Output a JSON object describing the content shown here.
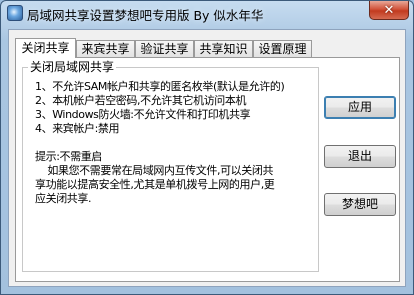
{
  "window": {
    "title": "局域网共享设置梦想吧专用版 By 似水年华",
    "close_symbol": "✕"
  },
  "tabs": [
    {
      "label": "关闭共享",
      "active": true
    },
    {
      "label": "来宾共享",
      "active": false
    },
    {
      "label": "验证共享",
      "active": false
    },
    {
      "label": "共享知识",
      "active": false
    },
    {
      "label": "设置原理",
      "active": false
    }
  ],
  "panel": {
    "group_title": "关闭局域网共享",
    "info_text": "1、不允许SAM帐户和共享的匿名枚举(默认是允许的)\n2、本机帐户若空密码,不允许其它机访问本机\n3、Windows防火墙:不允许文件和打印机共享\n4、来宾帐户:禁用\n\n提示:不需重启\n    如果您不需要常在局域网内互传文件,可以关闭共\n享功能以提高安全性,尤其是单机拨号上网的用户,更\n应关闭共享."
  },
  "buttons": {
    "apply": "应用",
    "exit": "退出",
    "dream": "梦想吧"
  }
}
